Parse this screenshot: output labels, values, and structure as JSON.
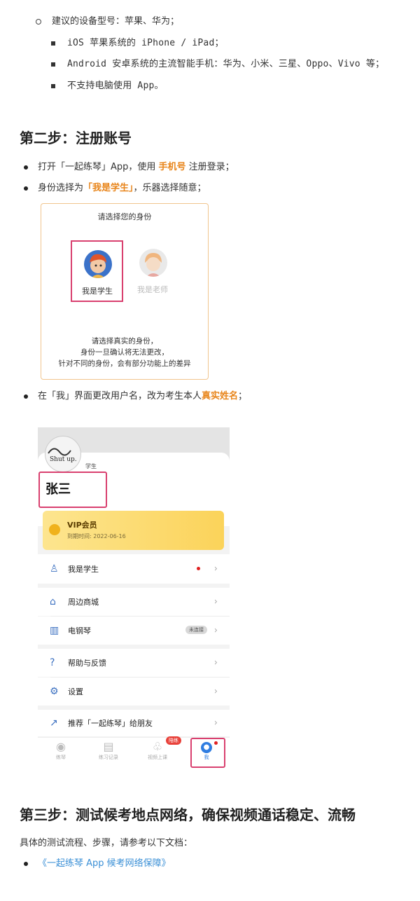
{
  "devices": {
    "recommended": "建议的设备型号：苹果、华为；",
    "ios": "iOS 苹果系统的 iPhone / iPad；",
    "android": "Android 安卓系统的主流智能手机：华为、小米、三星、Oppo、Vivo 等；",
    "no_pc": "不支持电脑使用 App。"
  },
  "step2": {
    "heading": "第二步：注册账号",
    "b1_pre": "打开「一起练琴」App，使用 ",
    "b1_em": "手机号",
    "b1_post": " 注册登录；",
    "b2_pre": "身份选择为",
    "b2_em": "「我是学生」",
    "b2_post": "，乐器选择随意；",
    "b3_pre": "在「我」界面更改用户名，改为考生本人",
    "b3_em": "真实姓名",
    "b3_post": "；"
  },
  "identity_card": {
    "title": "请选择您的身份",
    "student": "我是学生",
    "teacher": "我是老师",
    "note1": "请选择真实的身份，",
    "note2": "身份一旦确认将无法更改，",
    "note3": "针对不同的身份，会有部分功能上的差异"
  },
  "profile": {
    "avatar_text": "Shut up.",
    "role_tag": "学生",
    "name": "张三",
    "vip_title": "VIP会员",
    "vip_expiry": "到期时间: 2022-06-16",
    "menu": {
      "student": "我是学生",
      "shop": "周边商城",
      "piano": "电钢琴",
      "piano_badge": "未连接",
      "help": "帮助与反馈",
      "settings": "设置",
      "recommend": "推荐「一起练琴」给朋友"
    },
    "tabs": {
      "practice": "练琴",
      "records": "练习记录",
      "video": "视频上课",
      "video_badge": "陪练",
      "me": "我"
    }
  },
  "step3": {
    "heading": "第三步：测试候考地点网络，确保视频通话稳定、流畅",
    "intro": "具体的测试流程、步骤，请参考以下文档：",
    "link": "《一起练琴 App 候考网络保障》"
  },
  "colors": {
    "accent": "#e8851b",
    "highlight_box": "#d9406f",
    "link": "#3a8fd6"
  }
}
